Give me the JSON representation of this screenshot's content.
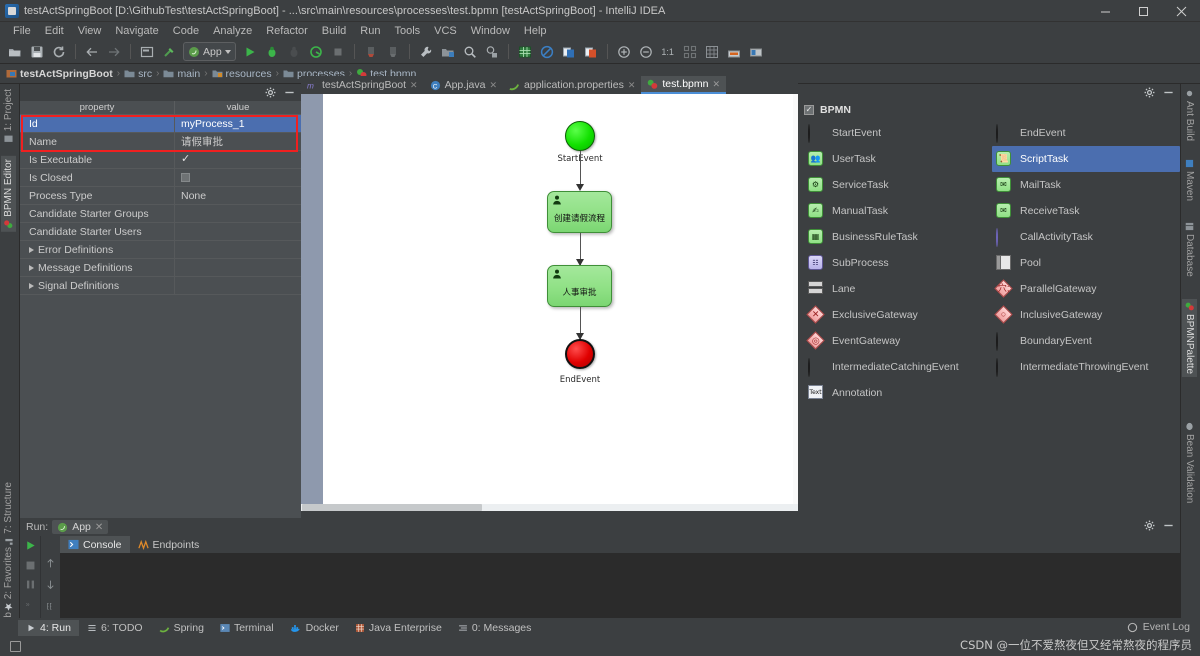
{
  "window": {
    "title": "testActSpringBoot [D:\\GithubTest\\testActSpringBoot] - ...\\src\\main\\resources\\processes\\test.bpmn [testActSpringBoot] - IntelliJ IDEA",
    "app_icon": "intellij-idea-icon",
    "controls": {
      "minimize": "minimize-icon",
      "maximize": "maximize-icon",
      "close": "close-icon"
    }
  },
  "menubar": {
    "items": [
      "File",
      "Edit",
      "View",
      "Navigate",
      "Code",
      "Analyze",
      "Refactor",
      "Build",
      "Run",
      "Tools",
      "VCS",
      "Window",
      "Help"
    ]
  },
  "toolbar": {
    "run_config_label": "App",
    "icons": [
      "open-folder-icon",
      "save-icon",
      "sync-icon",
      "back-arrow-icon",
      "forward-arrow-icon",
      "window-icon",
      "build-hammer-icon"
    ],
    "icons2": [
      "run-icon",
      "debug-icon",
      "coverage-icon",
      "run-with-profiler-icon",
      "stop-icon",
      "attach-icon",
      "attach2-icon",
      "wrench-icon",
      "project-structure-icon",
      "search-icon",
      "search-everywhere-icon",
      "database-green-icon",
      "disable-icon",
      "blue-doc-icon",
      "orange-doc-icon",
      "zoom-in-icon",
      "zoom-out-icon",
      "actual-size-icon",
      "fit-content-icon",
      "grid-icon",
      "deploy-icon",
      "toolwindow-icon"
    ]
  },
  "breadcrumb": {
    "items": [
      {
        "label": "testActSpringBoot",
        "icon": "module-icon",
        "bold": true
      },
      {
        "label": "src",
        "icon": "folder-icon",
        "bold": false
      },
      {
        "label": "main",
        "icon": "folder-icon",
        "bold": false
      },
      {
        "label": "resources",
        "icon": "resources-folder-icon",
        "bold": false
      },
      {
        "label": "processes",
        "icon": "folder-icon",
        "bold": false
      },
      {
        "label": "test.bpmn",
        "icon": "bpmn-file-icon",
        "bold": false
      }
    ]
  },
  "editor_tabs": [
    {
      "label": "testActSpringBoot",
      "icon": "maven-icon",
      "active": false
    },
    {
      "label": "App.java",
      "icon": "java-class-icon",
      "active": false
    },
    {
      "label": "application.properties",
      "icon": "properties-file-icon",
      "active": false
    },
    {
      "label": "test.bpmn",
      "icon": "bpmn-file-icon",
      "active": true
    }
  ],
  "left_toolwindow_tabs": [
    {
      "label": "1: Project",
      "icon": "project-icon"
    },
    {
      "label": "BPMN Editor",
      "icon": "bpmn-icon"
    },
    {
      "label": "7: Structure",
      "icon": "structure-icon"
    },
    {
      "label": "2: Favorites",
      "icon": "star-icon"
    },
    {
      "label": "Web",
      "icon": "web-icon"
    }
  ],
  "right_toolwindow_tabs": [
    {
      "label": "Ant Build",
      "icon": "ant-icon"
    },
    {
      "label": "Maven",
      "icon": "maven-icon"
    },
    {
      "label": "Database",
      "icon": "database-icon"
    },
    {
      "label": "BPMNPalette",
      "icon": "bpmn-palette-icon"
    },
    {
      "label": "Bean Validation",
      "icon": "bean-validation-icon"
    }
  ],
  "property_panel": {
    "header_settings_icon": "gear-icon",
    "header_hide_icon": "minimize-icon",
    "columns": [
      "property",
      "value"
    ],
    "rows": [
      {
        "name": "Id",
        "value": "myProcess_1",
        "selected": true,
        "type": "text",
        "expandable": false
      },
      {
        "name": "Name",
        "value": "请假审批",
        "selected": false,
        "type": "text",
        "expandable": false
      },
      {
        "name": "Is Executable",
        "value": "",
        "selected": false,
        "type": "checkbox-checked",
        "expandable": false
      },
      {
        "name": "Is Closed",
        "value": "",
        "selected": false,
        "type": "checkbox-unchecked",
        "expandable": false
      },
      {
        "name": "Process Type",
        "value": "None",
        "selected": false,
        "type": "text",
        "expandable": false
      },
      {
        "name": "Candidate Starter Groups",
        "value": "",
        "selected": false,
        "type": "text",
        "expandable": false
      },
      {
        "name": "Candidate Starter Users",
        "value": "",
        "selected": false,
        "type": "text",
        "expandable": false
      },
      {
        "name": "Error Definitions",
        "value": "",
        "selected": false,
        "type": "text",
        "expandable": true
      },
      {
        "name": "Message Definitions",
        "value": "",
        "selected": false,
        "type": "text",
        "expandable": true
      },
      {
        "name": "Signal Definitions",
        "value": "",
        "selected": false,
        "type": "text",
        "expandable": true
      }
    ]
  },
  "diagram": {
    "nodes": [
      {
        "id": "start",
        "type": "startEvent",
        "label": "StartEvent",
        "label_position": "below"
      },
      {
        "id": "task1",
        "type": "userTask",
        "label": "创建请假流程",
        "label_position": "inside",
        "icon": "user-icon"
      },
      {
        "id": "task2",
        "type": "userTask",
        "label": "人事审批",
        "label_position": "inside",
        "icon": "user-icon"
      },
      {
        "id": "end",
        "type": "endEvent",
        "label": "EndEvent",
        "label_position": "below"
      }
    ],
    "flows": [
      {
        "from": "start",
        "to": "task1"
      },
      {
        "from": "task1",
        "to": "task2"
      },
      {
        "from": "task2",
        "to": "end"
      }
    ]
  },
  "palette": {
    "settings_icon": "gear-icon",
    "hide_icon": "minimize-icon",
    "group_title": "BPMN",
    "group_checked": true,
    "items": [
      {
        "label": "StartEvent",
        "icon": "green-circle-icon",
        "selected": false
      },
      {
        "label": "EndEvent",
        "icon": "red-circle-icon",
        "selected": false
      },
      {
        "label": "UserTask",
        "icon": "user-task-icon",
        "selected": false
      },
      {
        "label": "ScriptTask",
        "icon": "script-task-icon",
        "selected": true
      },
      {
        "label": "ServiceTask",
        "icon": "service-task-icon",
        "selected": false
      },
      {
        "label": "MailTask",
        "icon": "mail-task-icon",
        "selected": false
      },
      {
        "label": "ManualTask",
        "icon": "manual-task-icon",
        "selected": false
      },
      {
        "label": "ReceiveTask",
        "icon": "receive-task-icon",
        "selected": false
      },
      {
        "label": "BusinessRuleTask",
        "icon": "business-rule-task-icon",
        "selected": false
      },
      {
        "label": "CallActivityTask",
        "icon": "call-activity-icon",
        "selected": false
      },
      {
        "label": "SubProcess",
        "icon": "subprocess-icon",
        "selected": false
      },
      {
        "label": "Pool",
        "icon": "pool-icon",
        "selected": false
      },
      {
        "label": "Lane",
        "icon": "lane-icon",
        "selected": false
      },
      {
        "label": "ParallelGateway",
        "icon": "parallel-gateway-icon",
        "selected": false
      },
      {
        "label": "ExclusiveGateway",
        "icon": "exclusive-gateway-icon",
        "selected": false
      },
      {
        "label": "InclusiveGateway",
        "icon": "inclusive-gateway-icon",
        "selected": false
      },
      {
        "label": "EventGateway",
        "icon": "event-gateway-icon",
        "selected": false
      },
      {
        "label": "BoundaryEvent",
        "icon": "boundary-event-icon",
        "selected": false
      },
      {
        "label": "IntermediateCatchingEvent",
        "icon": "intermediate-catching-event-icon",
        "selected": false
      },
      {
        "label": "IntermediateThrowingEvent",
        "icon": "intermediate-throwing-event-icon",
        "selected": false
      },
      {
        "label": "Annotation",
        "icon": "annotation-icon",
        "selected": false
      }
    ]
  },
  "run_panel": {
    "title": "Run:",
    "tab_label": "App",
    "tab_icon": "spring-boot-icon",
    "close_icon": "close-icon",
    "settings_icon": "gear-icon",
    "hide_icon": "minimize-icon",
    "subtabs": [
      {
        "label": "Console",
        "icon": "console-icon",
        "active": true
      },
      {
        "label": "Endpoints",
        "icon": "endpoints-icon",
        "active": false
      }
    ],
    "gutter_icons": [
      "rerun-icon",
      "stop-icon",
      "pause-icon",
      "trace-icon"
    ],
    "gutter2_icons": [
      "scroll-up-icon",
      "scroll-down-icon",
      "soft-wrap-icon"
    ],
    "console_text": ""
  },
  "status_bar": {
    "tools": [
      {
        "label": "4: Run",
        "mnemonic": "4",
        "icon": "run-icon",
        "active": true
      },
      {
        "label": "6: TODO",
        "mnemonic": "6",
        "icon": "todo-icon",
        "active": false
      },
      {
        "label": "Spring",
        "mnemonic": "",
        "icon": "spring-icon",
        "active": false
      },
      {
        "label": "Terminal",
        "mnemonic": "",
        "icon": "terminal-icon",
        "active": false
      },
      {
        "label": "Docker",
        "mnemonic": "",
        "icon": "docker-icon",
        "active": false
      },
      {
        "label": "Java Enterprise",
        "mnemonic": "",
        "icon": "java-enterprise-icon",
        "active": false
      },
      {
        "label": "0: Messages",
        "mnemonic": "0",
        "icon": "messages-icon",
        "active": false
      }
    ],
    "event_log": "Event Log",
    "event_log_icon": "event-log-icon",
    "watermark": "CSDN @一位不爱熬夜但又经常熬夜的程序员"
  },
  "colors": {
    "background": "#3c3f41",
    "panel": "#4b4f52",
    "selection": "#4b6eaf",
    "highlight_box": "#f02020",
    "canvas": "#ffffff",
    "canvas_gutter": "#8e99ad",
    "task_green": "#8ee084",
    "start_green": "#12e000",
    "end_red": "#e00000",
    "text": "#bbbbbb"
  }
}
